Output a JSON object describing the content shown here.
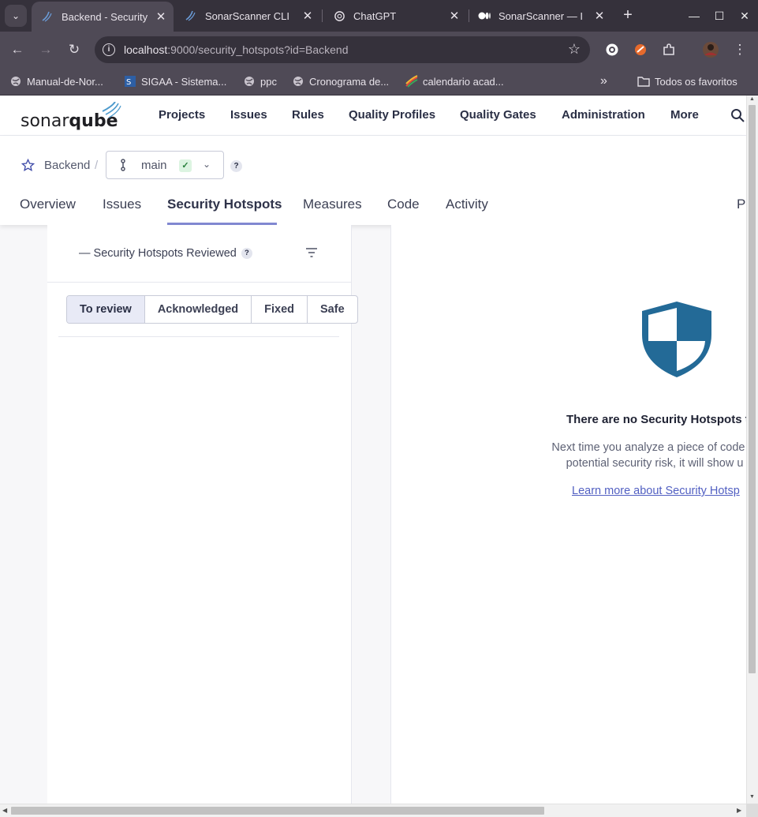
{
  "browser": {
    "tabs": [
      {
        "title": "Backend - Security",
        "favicon": "sonarqube-wave-icon",
        "active": true
      },
      {
        "title": "SonarScanner CLI",
        "favicon": "sonarqube-wave-icon",
        "active": false
      },
      {
        "title": "ChatGPT",
        "favicon": "chatgpt-icon",
        "active": false
      },
      {
        "title": "SonarScanner — I",
        "favicon": "medium-icon",
        "active": false
      }
    ],
    "url_host": "localhost",
    "url_rest": ":9000/security_hotspots?id=Backend",
    "bookmarks": [
      {
        "label": "Manual-de-Nor...",
        "icon": "globe-icon"
      },
      {
        "label": "SIGAA - Sistema...",
        "icon": "sigaa-icon"
      },
      {
        "label": "ppc",
        "icon": "globe-icon"
      },
      {
        "label": "Cronograma de...",
        "icon": "globe-icon"
      },
      {
        "label": "calendario acad...",
        "icon": "colorful-icon"
      }
    ],
    "bookmarks_more": "»",
    "all_bookmarks": "Todos os favoritos"
  },
  "sonar": {
    "nav": [
      "Projects",
      "Issues",
      "Rules",
      "Quality Profiles",
      "Quality Gates",
      "Administration",
      "More"
    ],
    "project": {
      "name": "Backend",
      "separator": "/",
      "branch": "main",
      "help": "?"
    },
    "tabs": [
      "Overview",
      "Issues",
      "Security Hotspots",
      "Measures",
      "Code",
      "Activity"
    ],
    "tabs_more": "P",
    "active_tab": "Security Hotspots"
  },
  "hotspots": {
    "reviewed_label": "— Security Hotspots Reviewed",
    "help": "?",
    "segments": [
      "To review",
      "Acknowledged",
      "Fixed",
      "Safe"
    ],
    "selected_segment": "To review"
  },
  "empty_state": {
    "title": "There are no Security Hotspots to",
    "line1": "Next time you analyze a piece of code th",
    "line2": "potential security risk, it will show u",
    "link": "Learn more about Security Hotsp"
  },
  "colors": {
    "shield": "#236a97",
    "accent_underline": "#8188d1",
    "link": "#5260c2"
  }
}
